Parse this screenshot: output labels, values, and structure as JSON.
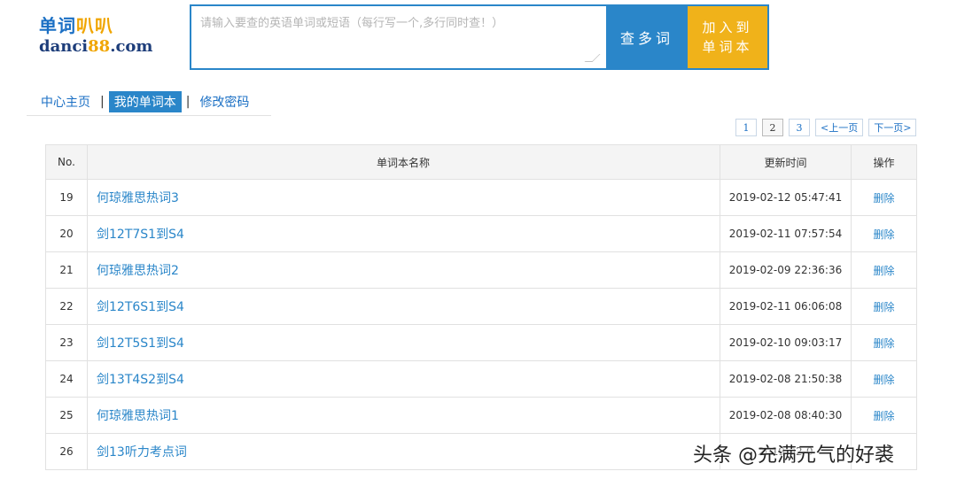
{
  "logo": {
    "cn_main": "单词",
    "cn_accent": "叭叭",
    "en_main": "danci",
    "en_accent": "88",
    "en_tail": ".com"
  },
  "search": {
    "placeholder": "请输入要查的英语单词或短语（每行写一个,多行同时查！）",
    "value": "",
    "lookup_label": "查多词",
    "add_label_line1": "加入到",
    "add_label_line2": "单词本"
  },
  "nav": {
    "home": "中心主页",
    "wordbooks": "我的单词本",
    "password": "修改密码",
    "separator": "|"
  },
  "pagination": {
    "pages": [
      "1",
      "2",
      "3"
    ],
    "current": "2",
    "prev": "<上一页",
    "next": "下一页>"
  },
  "table": {
    "headers": {
      "no": "No.",
      "name": "单词本名称",
      "time": "更新时间",
      "op": "操作"
    },
    "rows": [
      {
        "no": "19",
        "name": "何琼雅思热词3",
        "time": "2019-02-12 05:47:41",
        "op": "删除"
      },
      {
        "no": "20",
        "name": "剑12T7S1到S4",
        "time": "2019-02-11 07:57:54",
        "op": "删除"
      },
      {
        "no": "21",
        "name": "何琼雅思热词2",
        "time": "2019-02-09 22:36:36",
        "op": "删除"
      },
      {
        "no": "22",
        "name": "剑12T6S1到S4",
        "time": "2019-02-11 06:06:08",
        "op": "删除"
      },
      {
        "no": "23",
        "name": "剑12T5S1到S4",
        "time": "2019-02-10 09:03:17",
        "op": "删除"
      },
      {
        "no": "24",
        "name": "剑13T4S2到S4",
        "time": "2019-02-08 21:50:38",
        "op": "删除"
      },
      {
        "no": "25",
        "name": "何琼雅思热词1",
        "time": "2019-02-08 08:40:30",
        "op": "删除"
      },
      {
        "no": "26",
        "name": "剑13听力考点词",
        "time": "2019-02-0",
        "op": ""
      }
    ]
  },
  "watermark": "头条 @充满元气的好裘",
  "colors": {
    "primary": "#2a86c9",
    "accent": "#f0b21a",
    "link": "#1a6fc4"
  }
}
